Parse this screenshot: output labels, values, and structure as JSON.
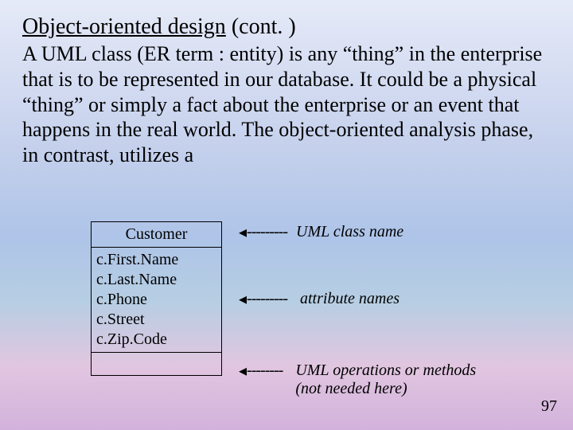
{
  "title": {
    "underlined": "Object-oriented design",
    "rest": " (cont. )"
  },
  "paragraph": "A UML class (ER term : entity) is any “thing” in the enterprise that is to be represented in our database. It could be a physical “thing” or simply a fact about the enterprise or an event that happens in the real world. The object-oriented analysis phase, in contrast, utilizes a",
  "uml": {
    "className": "Customer",
    "attributes": [
      "c.First.Name",
      "c.Last.Name",
      "c.Phone",
      "c.Street",
      "c.Zip.Code"
    ]
  },
  "annotations": {
    "className": "UML class name",
    "attributes": "attribute names",
    "operations_l1": "UML operations or methods",
    "operations_l2": "(not needed here)"
  },
  "dashes": "---------",
  "dashes_short": "--------",
  "arrowhead": "◂",
  "pageNumber": "97"
}
